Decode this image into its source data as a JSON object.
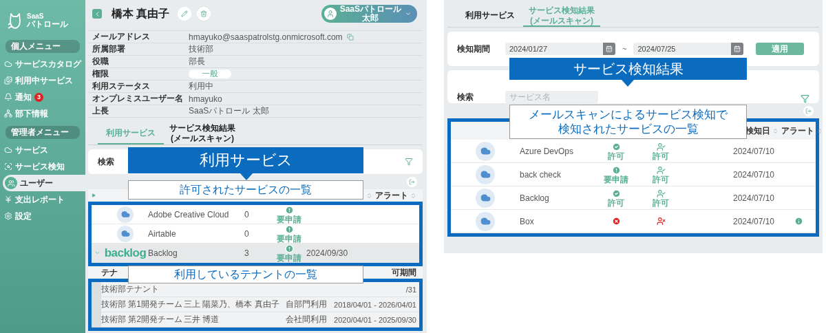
{
  "sidebar": {
    "logo_lines": [
      "SaaS",
      "パトロール"
    ],
    "sections": [
      {
        "label": "個人メニュー",
        "items": [
          {
            "label": "サービスカタログ",
            "selected": false
          },
          {
            "label": "利用中サービス",
            "selected": false
          },
          {
            "label": "通知",
            "selected": false,
            "badge": "3"
          },
          {
            "label": "部下情報",
            "selected": false
          }
        ]
      },
      {
        "label": "管理者メニュー",
        "items": [
          {
            "label": "サービス",
            "selected": false
          },
          {
            "label": "サービス検知",
            "selected": false
          },
          {
            "label": "ユーザー",
            "selected": true
          },
          {
            "label": "支出レポート",
            "selected": false
          },
          {
            "label": "設定",
            "selected": false
          }
        ]
      }
    ]
  },
  "user_page": {
    "name": "橋本 真由子",
    "account": {
      "name": "SaaSパトロール",
      "sub": "太郎"
    },
    "details": [
      {
        "label": "メールアドレス",
        "value": "hmayuko@saaspatrolstg.onmicrosoft.com",
        "kind": "copyable"
      },
      {
        "label": "所属部署",
        "value": "技術部",
        "kind": "text"
      },
      {
        "label": "役職",
        "value": "部長",
        "kind": "text"
      },
      {
        "label": "権限",
        "value": "一般",
        "kind": "pill"
      },
      {
        "label": "利用ステータス",
        "value": "利用中",
        "kind": "text"
      },
      {
        "label": "オンプレミスユーザー名",
        "value": "hmayuko",
        "kind": "text"
      },
      {
        "label": "上長",
        "value": "SaaSパトロール 太郎",
        "kind": "text"
      }
    ],
    "tabs": [
      {
        "label": "利用サービス",
        "selected": true
      },
      {
        "label": "サービス検知結果\n(メールスキャン)",
        "selected": false
      }
    ],
    "search": {
      "label": "検索"
    },
    "services_table": {
      "header": {
        "alert": "アラート"
      },
      "rows": [
        {
          "name": "Adobe Creative Cloud",
          "count": "0",
          "status": {
            "kind": "needs_request",
            "label": "要申請"
          },
          "expanded": false
        },
        {
          "name": "Airtable",
          "count": "0",
          "status": {
            "kind": "needs_request",
            "label": "要申請"
          },
          "expanded": false
        },
        {
          "logo": "backlog",
          "name": "Backlog",
          "count": "3",
          "status": {
            "kind": "needs_request",
            "label": "要申請"
          },
          "date": "2024/09/30",
          "expanded": true
        }
      ]
    },
    "tenants_table": {
      "header": {
        "column_1": "テナ",
        "column_4": "可期間"
      },
      "rows": [
        {
          "name": "技術部テナント",
          "period": "/31"
        },
        {
          "name": "技術部 第1開発チーム",
          "members": "三上 陽菜乃、橋本 真由子",
          "usage": "自部門利用",
          "period": "2018/04/01 - 2026/04/01"
        },
        {
          "name": "技術部 第2開発チーム",
          "members": "三井 博道",
          "usage": "会社間利用",
          "period": "2020/04/01 - 2025/09/30"
        }
      ]
    },
    "callouts": [
      {
        "title": "利用サービス",
        "caption": "許可されたサービスの一覧"
      },
      {
        "caption": "利用しているテナントの一覧"
      }
    ]
  },
  "detection_page": {
    "tabs": [
      {
        "label": "利用サービス",
        "selected": false
      },
      {
        "label": "サービス検知結果\n(メールスキャン)",
        "selected": true
      }
    ],
    "period": {
      "label": "検知期間",
      "from": "2024/01/27",
      "separator": "~",
      "to": "2024/07/25",
      "apply": "適用"
    },
    "search": {
      "label": "検索",
      "placeholder": "サービス名"
    },
    "table": {
      "header": {
        "date": "検知日",
        "alert": "アラート"
      },
      "rows": [
        {
          "name": "Azure DevOps",
          "status": {
            "kind": "approved",
            "label": "許可"
          },
          "user_status": {
            "kind": "approved",
            "label": "許可"
          },
          "date": "2024/07/10",
          "alert": false
        },
        {
          "name": "back check",
          "status": {
            "kind": "needs_request",
            "label": "要申請"
          },
          "user_status": {
            "kind": "approved",
            "label": "許可"
          },
          "date": "2024/07/10",
          "alert": false
        },
        {
          "name": "Backlog",
          "status": {
            "kind": "approved",
            "label": "許可"
          },
          "user_status": {
            "kind": "approved",
            "label": "許可"
          },
          "date": "2024/07/10",
          "alert": false
        },
        {
          "name": "Box",
          "status": {
            "kind": "denied"
          },
          "user_status": {
            "kind": "denied"
          },
          "date": "2024/07/10",
          "alert": true
        }
      ]
    },
    "callout": {
      "title": "サービス検知結果",
      "caption_lines": [
        "メールスキャンによるサービス検知で",
        "検知されたサービスの一覧"
      ]
    }
  }
}
